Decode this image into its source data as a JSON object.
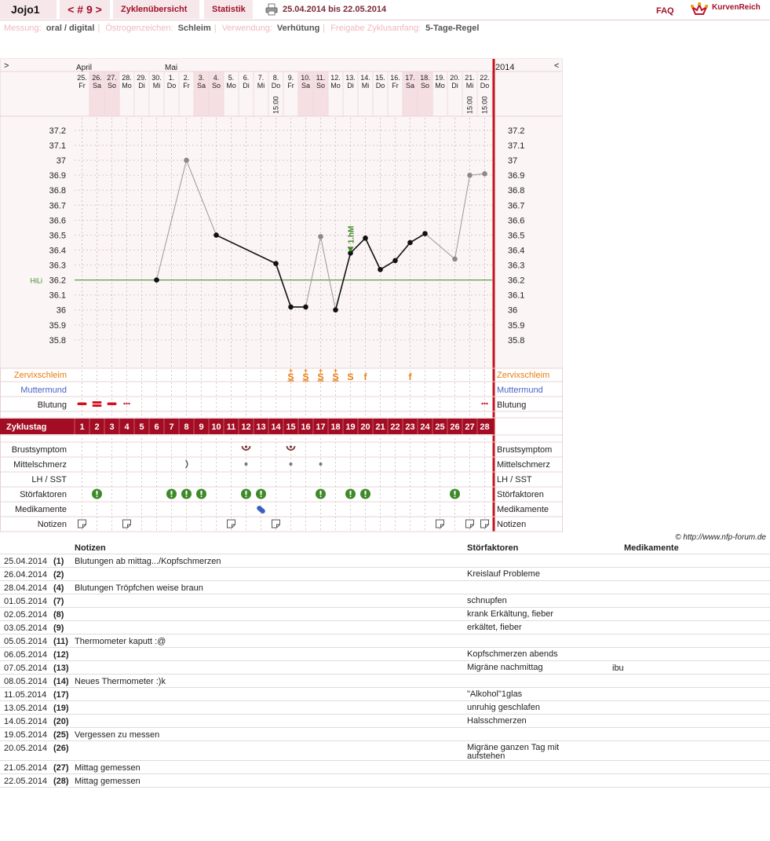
{
  "header": {
    "user": "Jojo1",
    "cycle_nav": "< # 9 >",
    "tab_overview": "Zyklenübersicht",
    "tab_statistics": "Statistik",
    "date_range": "25.04.2014 bis 22.05.2014",
    "faq": "FAQ",
    "logo_text": "KurvenReich"
  },
  "settings": [
    {
      "key": "Messung:",
      "value": "oral / digital"
    },
    {
      "key": "Östrogenzeichen:",
      "value": "Schleim"
    },
    {
      "key": "Verwendung:",
      "value": "Verhütung"
    },
    {
      "key": "Freigabe Zyklusanfang:",
      "value": "5-Tage-Regel"
    }
  ],
  "chart_data": {
    "type": "line",
    "title": "",
    "year_label": "2014",
    "nav_left": ">",
    "nav_right": "<",
    "month_labels": [
      "April",
      "Mai"
    ],
    "dates": [
      "25.",
      "26.",
      "27.",
      "28.",
      "29.",
      "30.",
      "1.",
      "2.",
      "3.",
      "4.",
      "5.",
      "6.",
      "7.",
      "8.",
      "9.",
      "10.",
      "11.",
      "12.",
      "13.",
      "14.",
      "15.",
      "16.",
      "17.",
      "18.",
      "19.",
      "20.",
      "21.",
      "22."
    ],
    "weekdays": [
      "Fr",
      "Sa",
      "So",
      "Mo",
      "Di",
      "Mi",
      "Do",
      "Fr",
      "Sa",
      "So",
      "Mo",
      "Di",
      "Mi",
      "Do",
      "Fr",
      "Sa",
      "So",
      "Mo",
      "Di",
      "Mi",
      "Do",
      "Fr",
      "Sa",
      "So",
      "Mo",
      "Di",
      "Mi",
      "Do"
    ],
    "weekend": [
      false,
      true,
      true,
      false,
      false,
      false,
      false,
      false,
      true,
      true,
      false,
      false,
      false,
      false,
      false,
      true,
      true,
      false,
      false,
      false,
      false,
      false,
      true,
      true,
      false,
      false,
      false,
      false
    ],
    "time_labels": {
      "14": "15:00",
      "27": "15:00",
      "28": "15:00"
    },
    "cycle_days": [
      1,
      2,
      3,
      4,
      5,
      6,
      7,
      8,
      9,
      10,
      11,
      12,
      13,
      14,
      15,
      16,
      17,
      18,
      19,
      20,
      21,
      22,
      23,
      24,
      25,
      26,
      27,
      28
    ],
    "y_ticks": [
      37.2,
      37.1,
      37,
      36.9,
      36.8,
      36.7,
      36.6,
      36.5,
      36.4,
      36.3,
      36.2,
      36.1,
      36,
      35.9,
      35.8
    ],
    "ylim": [
      35.75,
      37.25
    ],
    "hili_label": "HiLi",
    "hili_value": 36.2,
    "temperatures": [
      {
        "day": 6,
        "value": 36.2,
        "excluded": false
      },
      {
        "day": 8,
        "value": 37.0,
        "excluded": true
      },
      {
        "day": 10,
        "value": 36.5,
        "excluded": false
      },
      {
        "day": 14,
        "value": 36.31,
        "excluded": false
      },
      {
        "day": 15,
        "value": 36.02,
        "excluded": false
      },
      {
        "day": 16,
        "value": 36.02,
        "excluded": false
      },
      {
        "day": 17,
        "value": 36.49,
        "excluded": true
      },
      {
        "day": 18,
        "value": 36.0,
        "excluded": false
      },
      {
        "day": 19,
        "value": 36.38,
        "excluded": false
      },
      {
        "day": 20,
        "value": 36.48,
        "excluded": false
      },
      {
        "day": 21,
        "value": 36.27,
        "excluded": false
      },
      {
        "day": 22,
        "value": 36.33,
        "excluded": false
      },
      {
        "day": 23,
        "value": 36.45,
        "excluded": false
      },
      {
        "day": 24,
        "value": 36.51,
        "excluded": false
      },
      {
        "day": 26,
        "value": 36.34,
        "excluded": true
      },
      {
        "day": 27,
        "value": 36.9,
        "excluded": true
      },
      {
        "day": 28,
        "value": 36.91,
        "excluded": true
      }
    ],
    "marker": {
      "day": 19,
      "label": "1.hM"
    },
    "rows": {
      "zervix": "Zervixschleim",
      "muttermund": "Muttermund",
      "blutung": "Blutung",
      "zyklustag": "Zyklustag",
      "brust": "Brustsymptom",
      "mittel": "Mittelschmerz",
      "lh": "LH / SST",
      "stoer": "Störfaktoren",
      "medik": "Medikamente",
      "notizen": "Notizen"
    },
    "zervix_marks": [
      {
        "day": 15,
        "symbol": "S+"
      },
      {
        "day": 16,
        "symbol": "S+"
      },
      {
        "day": 17,
        "symbol": "S+"
      },
      {
        "day": 18,
        "symbol": "S+"
      },
      {
        "day": 19,
        "symbol": "S"
      },
      {
        "day": 20,
        "symbol": "f"
      },
      {
        "day": 23,
        "symbol": "f"
      }
    ],
    "blutung_marks": [
      {
        "day": 1,
        "type": "medium"
      },
      {
        "day": 2,
        "type": "strong"
      },
      {
        "day": 3,
        "type": "medium"
      },
      {
        "day": 4,
        "type": "spotting"
      },
      {
        "day": 28,
        "type": "spotting"
      }
    ],
    "brust_days": [
      12,
      15
    ],
    "mittel_marks": [
      {
        "day": 8,
        "type": "arc"
      },
      {
        "day": 12,
        "type": "dot"
      },
      {
        "day": 15,
        "type": "dot"
      },
      {
        "day": 17,
        "type": "dot"
      }
    ],
    "stoer_days": [
      2,
      7,
      8,
      9,
      12,
      13,
      17,
      19,
      20,
      26
    ],
    "medik_days": [
      13
    ],
    "notiz_days": [
      1,
      4,
      11,
      14,
      25,
      27,
      28
    ]
  },
  "copyright": "© http://www.nfp-forum.de",
  "notes_table": {
    "headers": {
      "notes": "Notizen",
      "stoer": "Störfaktoren",
      "medik": "Medikamente"
    },
    "rows": [
      {
        "date": "25.04.2014",
        "day": "(1)",
        "note": "Blutungen ab mittag.../Kopfschmerzen",
        "stoer": "",
        "med": ""
      },
      {
        "date": "26.04.2014",
        "day": "(2)",
        "note": "",
        "stoer": "Kreislauf Probleme",
        "med": ""
      },
      {
        "date": "28.04.2014",
        "day": "(4)",
        "note": "Blutungen Tröpfchen weise braun",
        "stoer": "",
        "med": ""
      },
      {
        "date": "01.05.2014",
        "day": "(7)",
        "note": "",
        "stoer": "schnupfen",
        "med": ""
      },
      {
        "date": "02.05.2014",
        "day": "(8)",
        "note": "",
        "stoer": "krank Erkältung, fieber",
        "med": ""
      },
      {
        "date": "03.05.2014",
        "day": "(9)",
        "note": "",
        "stoer": "erkältet, fieber",
        "med": ""
      },
      {
        "date": "05.05.2014",
        "day": "(11)",
        "note": "Thermometer kaputt :@",
        "stoer": "",
        "med": ""
      },
      {
        "date": "06.05.2014",
        "day": "(12)",
        "note": "",
        "stoer": "Kopfschmerzen abends",
        "med": ""
      },
      {
        "date": "07.05.2014",
        "day": "(13)",
        "note": "",
        "stoer": "Migräne nachmittag",
        "med": "ibu"
      },
      {
        "date": "08.05.2014",
        "day": "(14)",
        "note": "Neues Thermometer :)k",
        "stoer": "",
        "med": ""
      },
      {
        "date": "11.05.2014",
        "day": "(17)",
        "note": "",
        "stoer": "\"Alkohol\"1glas",
        "med": ""
      },
      {
        "date": "13.05.2014",
        "day": "(19)",
        "note": "",
        "stoer": "unruhig geschlafen",
        "med": ""
      },
      {
        "date": "14.05.2014",
        "day": "(20)",
        "note": "",
        "stoer": "Halsschmerzen",
        "med": ""
      },
      {
        "date": "19.05.2014",
        "day": "(25)",
        "note": "Vergessen zu messen",
        "stoer": "",
        "med": ""
      },
      {
        "date": "20.05.2014",
        "day": "(26)",
        "note": "",
        "stoer": "Migräne ganzen Tag mit aufstehen",
        "med": ""
      },
      {
        "date": "21.05.2014",
        "day": "(27)",
        "note": "Mittag gemessen",
        "stoer": "",
        "med": ""
      },
      {
        "date": "22.05.2014",
        "day": "(28)",
        "note": "Mittag gemessen",
        "stoer": "",
        "med": ""
      }
    ]
  }
}
